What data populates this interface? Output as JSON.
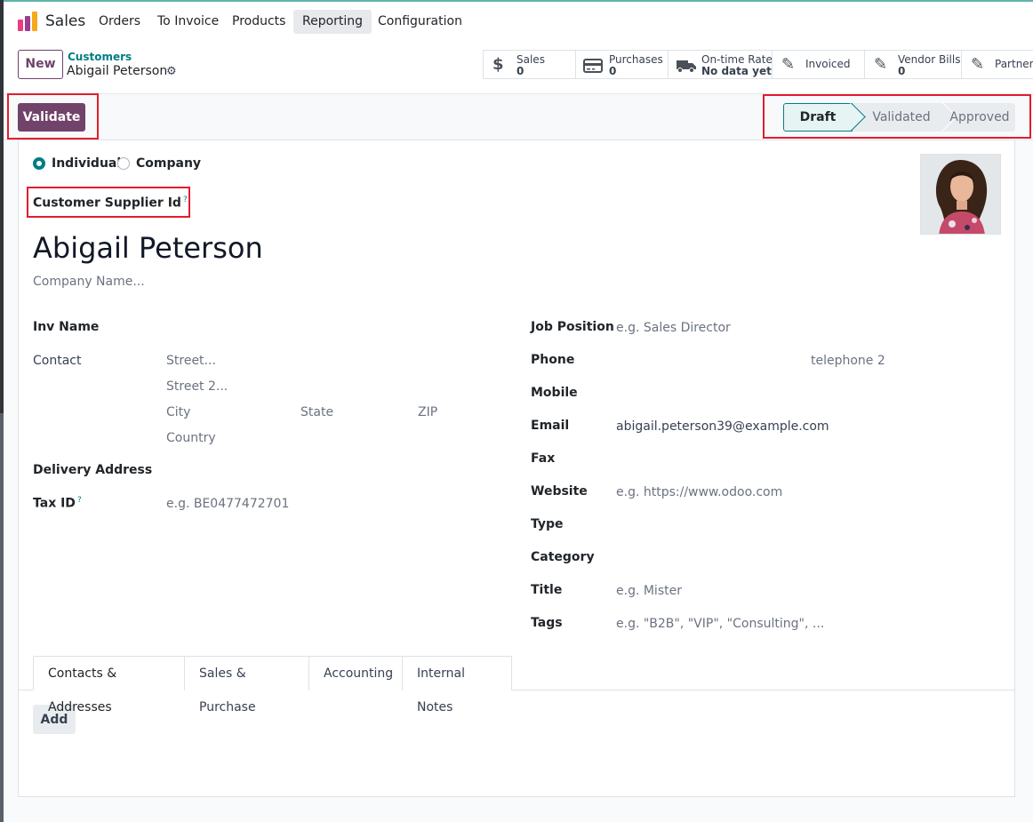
{
  "navbar": {
    "app_name": "Sales",
    "menu": [
      "Orders",
      "To Invoice",
      "Products",
      "Reporting",
      "Configuration"
    ],
    "active_menu": "Reporting"
  },
  "control": {
    "new_label": "New",
    "breadcrumb_parent": "Customers",
    "breadcrumb_current": "Abigail Peterson"
  },
  "smart_buttons": [
    {
      "icon": "dollar-icon",
      "glyph": "$",
      "label": "Sales",
      "value": "0"
    },
    {
      "icon": "credit-card-icon",
      "glyph": "▭",
      "label": "Purchases",
      "value": "0"
    },
    {
      "icon": "truck-icon",
      "glyph": "⛟",
      "label": "On-time Rate",
      "value": "No data yet"
    },
    {
      "icon": "edit-icon",
      "glyph": "✎",
      "label": "Invoiced",
      "value": ""
    },
    {
      "icon": "edit-icon",
      "glyph": "✎",
      "label": "Vendor Bills",
      "value": "0"
    },
    {
      "icon": "edit-icon",
      "glyph": "✎",
      "label": "Partner L",
      "value": ""
    }
  ],
  "status": {
    "validate_label": "Validate",
    "stages": [
      "Draft",
      "Validated",
      "Approved"
    ],
    "current_stage": "Draft"
  },
  "form": {
    "type_individual": "Individual",
    "type_company": "Company",
    "selected_type": "Individual",
    "supplier_id_label": "Customer Supplier Id",
    "tooltip_mark": "?",
    "name": "Abigail Peterson",
    "company_placeholder": "Company Name...",
    "inv_name_label": "Inv Name",
    "contact_label": "Contact",
    "street_ph": "Street...",
    "street2_ph": "Street 2...",
    "city_ph": "City",
    "state_ph": "State",
    "zip_ph": "ZIP",
    "country_ph": "Country",
    "delivery_label": "Delivery Address",
    "tax_label": "Tax ID",
    "tax_ph": "e.g. BE0477472701",
    "job_label": "Job Position",
    "job_ph": "e.g. Sales Director",
    "phone_label": "Phone",
    "phone2_ph": "telephone 2",
    "mobile_label": "Mobile",
    "email_label": "Email",
    "email_value": "abigail.peterson39@example.com",
    "fax_label": "Fax",
    "website_label": "Website",
    "website_ph": "e.g. https://www.odoo.com",
    "type_label": "Type",
    "category_label": "Category",
    "title_label": "Title",
    "title_ph": "e.g. Mister",
    "tags_label": "Tags",
    "tags_ph": "e.g. \"B2B\", \"VIP\", \"Consulting\", ..."
  },
  "tabs": [
    "Contacts & Addresses",
    "Sales & Purchase",
    "Accounting",
    "Internal Notes"
  ],
  "active_tab": "Contacts & Addresses",
  "add_label": "Add",
  "colors": {
    "brand": "#71426a",
    "accent": "#017e84",
    "highlight": "#e11d2e"
  }
}
